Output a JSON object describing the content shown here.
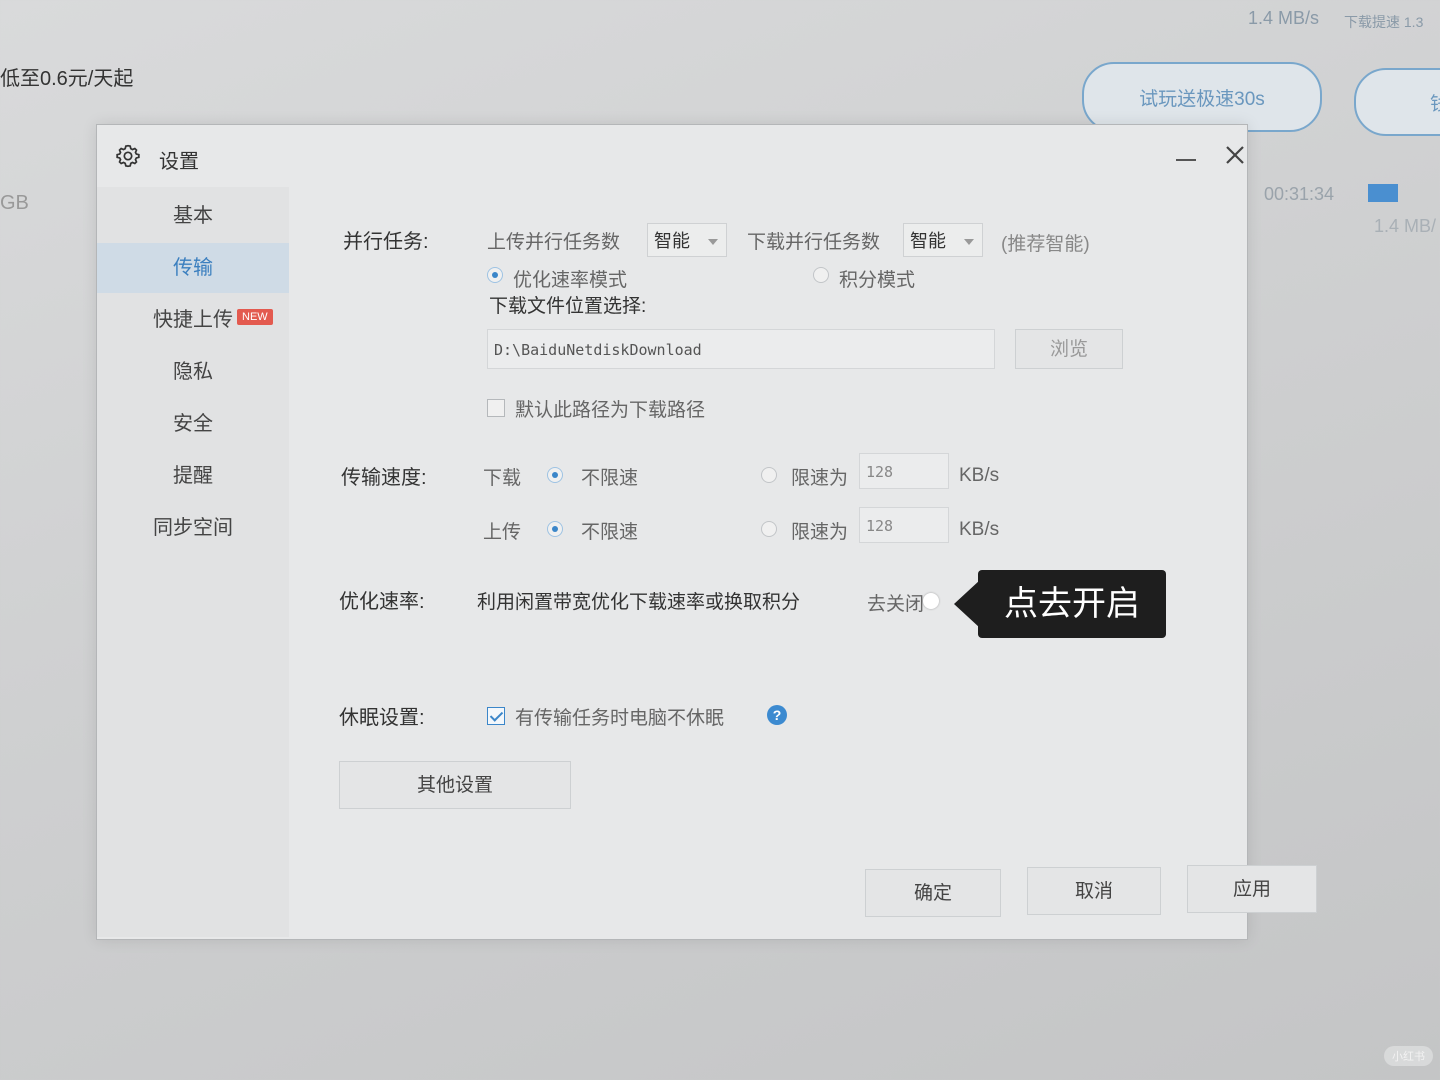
{
  "background": {
    "price_text": "低至0.6元/天起",
    "speed": "1.4 MB/s",
    "speed_label": "下载提速 1.3",
    "size_fragment": "GB",
    "elapsed": "00:31:34",
    "speed2": "1.4 MB/",
    "trial_button": "试玩送极速30s",
    "right_button": "钱",
    "accent": "#4a8fd0"
  },
  "dialog": {
    "title": "设置",
    "icons": {
      "settings": "gear-icon",
      "minimize": "minimize-icon",
      "close": "close-icon"
    }
  },
  "sidebar": {
    "items": [
      {
        "label": "基本"
      },
      {
        "label": "传输",
        "active": true
      },
      {
        "label": "快捷上传",
        "badge": "NEW"
      },
      {
        "label": "隐私"
      },
      {
        "label": "安全"
      },
      {
        "label": "提醒"
      },
      {
        "label": "同步空间"
      }
    ]
  },
  "parallel": {
    "label": "并行任务:",
    "upload_label": "上传并行任务数",
    "upload_value": "智能",
    "download_label": "下载并行任务数",
    "download_value": "智能",
    "hint": "(推荐智能)"
  },
  "download_location": {
    "label": "下载文件位置选择:",
    "path": "D:\\BaiduNetdiskDownload",
    "browse_button": "浏览",
    "default_checkbox_label": "默认此路径为下载路径",
    "default_checked": false
  },
  "speed": {
    "label": "传输速度:",
    "download": {
      "label": "下载",
      "unlimited": "不限速",
      "unlimited_selected": true,
      "limit_label": "限速为",
      "limit_value": "128",
      "unit": "KB/s"
    },
    "upload": {
      "label": "上传",
      "unlimited": "不限速",
      "unlimited_selected": true,
      "limit_label": "限速为",
      "limit_value": "128",
      "unit": "KB/s"
    }
  },
  "optimize": {
    "label": "优化速率:",
    "description": "利用闲置带宽优化下载速率或换取积分",
    "toggle_text": "去关闭",
    "mode_speed": "优化速率模式",
    "mode_speed_selected": true,
    "mode_points": "积分模式"
  },
  "sleep": {
    "label": "休眠设置:",
    "checkbox_label": "有传输任务时电脑不休眠",
    "checked": true,
    "help_icon": "?"
  },
  "other_settings_button": "其他设置",
  "footer": {
    "ok": "确定",
    "cancel": "取消",
    "apply": "应用"
  },
  "annotation": {
    "text": "点去开启"
  },
  "watermark": "小红书"
}
